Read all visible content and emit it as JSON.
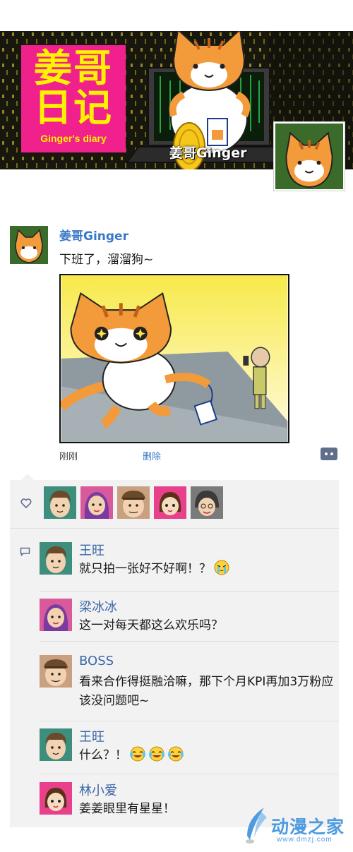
{
  "cover": {
    "title_line1": "姜哥",
    "title_line2": "日记",
    "subtitle": "Ginger's diary",
    "name": "姜哥Ginger"
  },
  "post": {
    "author": "姜哥Ginger",
    "text": "下班了，溜溜狗~",
    "time": "刚刚",
    "delete_label": "删除"
  },
  "likes": {
    "icon": "heart-icon",
    "avatars": [
      "王旺",
      "梁冰冰",
      "BOSS",
      "林小爱",
      "grandma"
    ]
  },
  "comments": [
    {
      "name": "王旺",
      "text": "就只拍一张好不好啊！？",
      "emojis": [
        "crying-emoji"
      ]
    },
    {
      "name": "梁冰冰",
      "text": "这一对每天都这么欢乐吗？",
      "emojis": []
    },
    {
      "name": "BOSS",
      "text": "看来合作得挺融洽嘛，那下个月KPI再加3万粉应该没问题吧~",
      "emojis": []
    },
    {
      "name": "王旺",
      "text": "什么？！",
      "emojis": [
        "laugh-cry-emoji",
        "laugh-cry-emoji",
        "laugh-cry-emoji"
      ]
    },
    {
      "name": "林小爱",
      "text": "姜姜眼里有星星！",
      "emojis": []
    }
  ],
  "watermark": {
    "name": "动漫之家",
    "url": "www.dmzj.com"
  },
  "colors": {
    "title_bg": "#f0208c",
    "title_text": "#fff200",
    "link_blue": "#3a78c8",
    "panel_bg": "#f2f2f2",
    "cat_orange": "#f39a3a"
  }
}
